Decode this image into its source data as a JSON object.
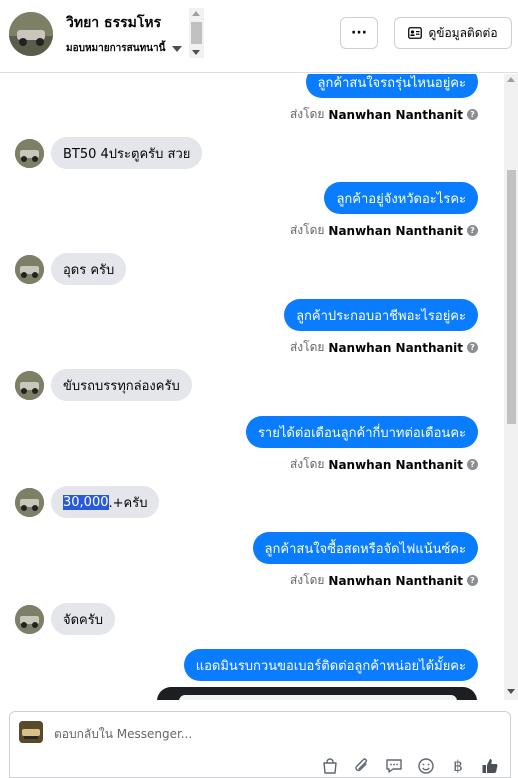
{
  "header": {
    "contact_name": "วิทยา ธรรมโหร",
    "assign_label": "มอบหมายการสนทนานี้",
    "more_label": "···",
    "contact_info_label": "ดูข้อมูลติดต่อ"
  },
  "sent_by": {
    "prefix": "ส่งโดย",
    "name": "Nanwhan Nanthanit",
    "help": "?"
  },
  "messages": [
    {
      "dir": "out",
      "text": "ลูกค้าสนใจรถรุ่นไหนอยู่คะ"
    },
    {
      "dir": "in",
      "text": "BT50 4ประตูครับ สวย"
    },
    {
      "dir": "out",
      "text": "ลูกค้าอยู่จังหวัดอะไรคะ"
    },
    {
      "dir": "in",
      "text": "อุดร ครับ"
    },
    {
      "dir": "out",
      "text": "ลูกค้าประกอบอาชีพอะไรอยู่คะ"
    },
    {
      "dir": "in",
      "text": "ขับรถบรรทุกล่องครับ"
    },
    {
      "dir": "out",
      "text": "รายได้ต่อเดือนลูกค้ากี่บาทต่อเดือนคะ"
    },
    {
      "dir": "in",
      "text_highlight": "30,000",
      "text_rest": ".+ครับ"
    },
    {
      "dir": "out",
      "text": "ลูกค้าสนใจซื้อสดหรือจัดไฟแน้นซ์คะ"
    },
    {
      "dir": "in",
      "text": "จัดครับ"
    },
    {
      "dir": "out",
      "text": "แอดมินรบกวนขอเบอร์ติดต่อลูกค้าหน่อยได้มั้ยคะ"
    }
  ],
  "composer": {
    "placeholder": "ตอบกลับใน Messenger...",
    "baht_symbol": "฿"
  },
  "colors": {
    "outgoing_bubble": "#0a7cff",
    "incoming_bubble": "#e4e6eb",
    "highlight": "#2a5bd7"
  }
}
